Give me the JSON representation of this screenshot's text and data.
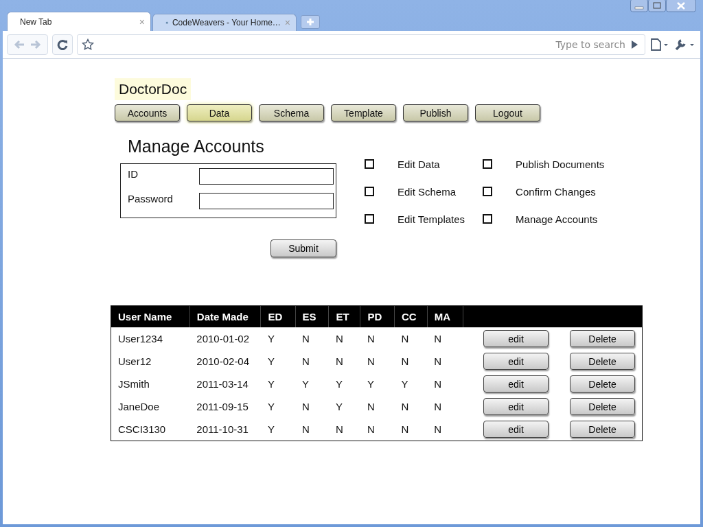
{
  "browser": {
    "tabs": [
      {
        "label": "New Tab",
        "close": "×",
        "selected": true
      },
      {
        "label": "CodeWeavers - Your Home…",
        "close": "×",
        "selected": false
      }
    ],
    "search": {
      "placeholder": "Type to search"
    }
  },
  "app": {
    "title": "DoctorDoc",
    "nav": [
      {
        "label": "Accounts",
        "selected": false
      },
      {
        "label": "Data",
        "selected": true
      },
      {
        "label": "Schema",
        "selected": false
      },
      {
        "label": "Template",
        "selected": false
      },
      {
        "label": "Publish",
        "selected": false
      },
      {
        "label": "Logout",
        "selected": false
      }
    ],
    "heading": "Manage Accounts",
    "form": {
      "fields": [
        {
          "label": "ID"
        },
        {
          "label": "Password"
        }
      ],
      "submit": "Submit"
    },
    "permissions": [
      [
        {
          "label": "Edit Data",
          "checked": false
        },
        {
          "label": "Edit Schema",
          "checked": false
        },
        {
          "label": "Edit Templates",
          "checked": false
        }
      ],
      [
        {
          "label": "Publish Documents",
          "checked": false
        },
        {
          "label": "Confirm Changes",
          "checked": false
        },
        {
          "label": "Manage Accounts",
          "checked": false
        }
      ]
    ],
    "table": {
      "columns": [
        "User Name",
        "Date Made",
        "ED",
        "ES",
        "ET",
        "PD",
        "CC",
        "MA"
      ],
      "rows": [
        {
          "cells": [
            "User1234",
            "2010-01-02",
            "Y",
            "N",
            "N",
            "N",
            "N",
            "N"
          ],
          "edit": "edit",
          "delete": "Delete"
        },
        {
          "cells": [
            "User12",
            "2010-02-04",
            "Y",
            "N",
            "N",
            "N",
            "N",
            "N"
          ],
          "edit": "edit",
          "delete": "Delete"
        },
        {
          "cells": [
            "JSmith",
            "2011-03-14",
            "Y",
            "Y",
            "Y",
            "Y",
            "Y",
            "N"
          ],
          "edit": "edit",
          "delete": "Delete"
        },
        {
          "cells": [
            "JaneDoe",
            "2011-09-15",
            "Y",
            "N",
            "Y",
            "N",
            "N",
            "N"
          ],
          "edit": "edit",
          "delete": "Delete"
        },
        {
          "cells": [
            "CSCI3130",
            "2011-10-31",
            "Y",
            "N",
            "N",
            "N",
            "N",
            "N"
          ],
          "edit": "edit",
          "delete": "Delete"
        }
      ]
    }
  }
}
